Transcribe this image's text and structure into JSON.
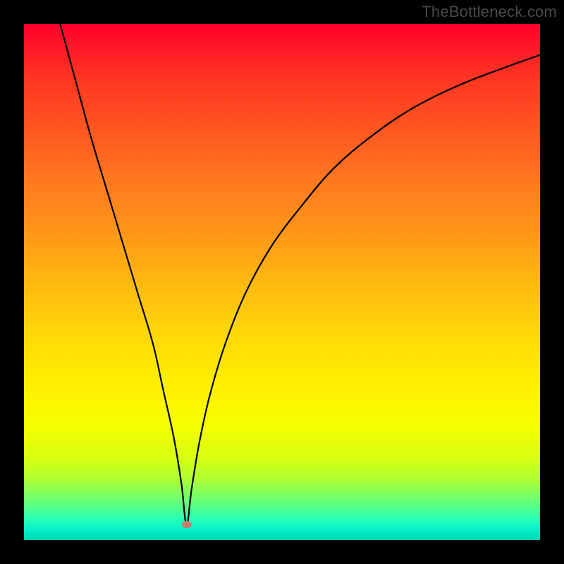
{
  "watermark": "TheBottleneck.com",
  "chart_data": {
    "type": "line",
    "title": "",
    "xlabel": "",
    "ylabel": "",
    "x_range": [
      0,
      100
    ],
    "y_range": [
      0,
      100
    ],
    "background_gradient": [
      "#ff0030",
      "#ffde00",
      "#00d8b0"
    ],
    "series": [
      {
        "name": "bottleneck-curve",
        "color": "#000000",
        "x": [
          7,
          10,
          13,
          16,
          19,
          22,
          25,
          27,
          29,
          30.5,
          31.5,
          32.5,
          34,
          36,
          39,
          43,
          48,
          54,
          60,
          67,
          75,
          84,
          93,
          100
        ],
        "values": [
          100,
          89,
          78,
          68,
          58,
          48,
          38,
          29,
          20,
          11,
          3,
          10,
          19,
          28,
          38,
          48,
          57,
          65,
          72,
          78,
          83.5,
          88,
          91.5,
          94
        ]
      }
    ],
    "minimum_point": {
      "x": 31.5,
      "y": 3,
      "color": "#cb7a6b"
    }
  }
}
